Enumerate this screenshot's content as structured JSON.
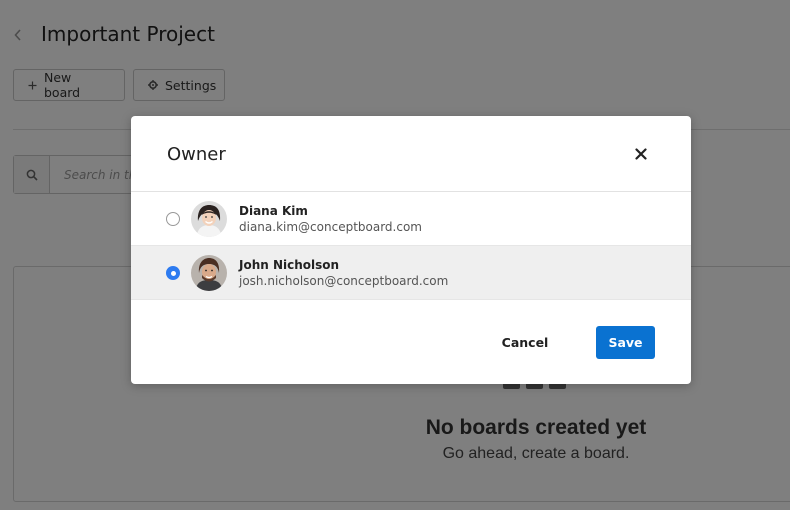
{
  "header": {
    "project_title": "Important Project"
  },
  "toolbar": {
    "new_board_label": "New board",
    "settings_label": "Settings"
  },
  "search": {
    "placeholder": "Search in this project"
  },
  "empty_state": {
    "title": "No boards created yet",
    "subtitle": "Go ahead, create a board."
  },
  "modal": {
    "title": "Owner",
    "owners": [
      {
        "name": "Diana Kim",
        "email": "diana.kim@conceptboard.com",
        "selected": false
      },
      {
        "name": "John Nicholson",
        "email": "josh.nicholson@conceptboard.com",
        "selected": true
      }
    ],
    "cancel_label": "Cancel",
    "save_label": "Save"
  },
  "colors": {
    "primary": "#0a72d1",
    "radio_checked": "#2d7bf0",
    "overlay": "rgba(0,0,0,0.5)"
  },
  "icons": {
    "back": "chevron-left-icon",
    "new_board": "plus-icon",
    "settings": "gear-icon",
    "search": "search-icon",
    "close": "close-icon"
  }
}
